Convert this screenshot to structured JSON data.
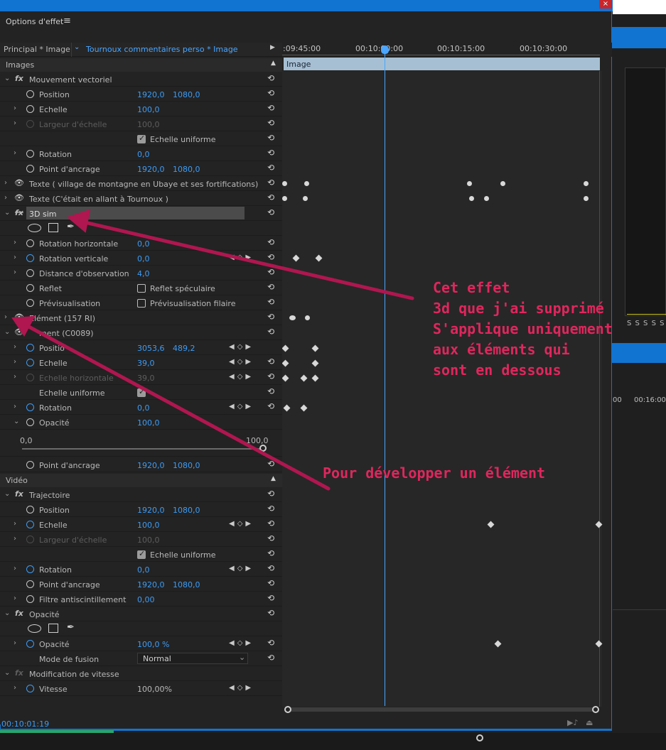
{
  "window": {
    "close_glyph": "×"
  },
  "panel": {
    "title": "Options d'effet",
    "menu_icon": "≡",
    "tab_master": "Principal * Image",
    "tab_clip": "Tournoux commentaires perso * Image",
    "play_glyph": "▶",
    "timecode": "00:10:01:19"
  },
  "ruler": {
    "ticks": [
      ":09:45:00",
      "00:10:00:00",
      "00:10:15:00",
      "00:10:30:00"
    ],
    "clip_label": "Image"
  },
  "sections": {
    "images": "Images",
    "video": "Vidéo"
  },
  "rows": {
    "mv_title": "Mouvement vectoriel",
    "mv_position": "Position",
    "mv_position_x": "1920,0",
    "mv_position_y": "1080,0",
    "mv_echelle": "Echelle",
    "mv_echelle_v": "100,0",
    "mv_largeur": "Largeur d'échelle",
    "mv_largeur_v": "100,0",
    "mv_uniforme": "Echelle uniforme",
    "mv_rotation": "Rotation",
    "mv_rotation_v": "0,0",
    "mv_ancrage": "Point d'ancrage",
    "mv_ancrage_x": "1920,0",
    "mv_ancrage_y": "1080,0",
    "texte1": "Texte ( village de montagne en Ubaye et ses fortifications)",
    "texte2": "Texte (C'était en allant à Tournoux )",
    "td_title": "3D sim",
    "td_rot_h": "Rotation horizontale",
    "td_rot_h_v": "0,0",
    "td_rot_v": "Rotation verticale",
    "td_rot_v_v": "0,0",
    "td_dist": "Distance d'observation",
    "td_dist_v": "4,0",
    "td_reflet": "Reflet",
    "td_reflet_opt": "Reflet spéculaire",
    "td_previs": "Prévisualisation",
    "td_previs_opt": "Prévisualisation filaire",
    "el1": "Elément (157 RI)",
    "el2": "ment (C0089)",
    "el2_position": "Positio",
    "el2_position_x": "3053,6",
    "el2_position_y": "489,2",
    "el2_echelle": "Echelle",
    "el2_echelle_v": "39,0",
    "el2_ech_h": "Echelle horizontale",
    "el2_ech_h_v": "39,0",
    "el2_uniforme": "Echelle uniforme",
    "el2_rotation": "Rotation",
    "el2_rotation_v": "0,0",
    "el2_opacite": "Opacité",
    "el2_opacite_v": "100,0",
    "slider_min": "0,0",
    "slider_max": "100,0",
    "el2_ancrage": "Point d'ancrage",
    "el2_ancrage_x": "1920,0",
    "el2_ancrage_y": "1080,0",
    "tr_title": "Trajectoire",
    "tr_position": "Position",
    "tr_position_x": "1920,0",
    "tr_position_y": "1080,0",
    "tr_echelle": "Echelle",
    "tr_echelle_v": "100,0",
    "tr_largeur": "Largeur d'échelle",
    "tr_largeur_v": "100,0",
    "tr_uniforme": "Echelle uniforme",
    "tr_rotation": "Rotation",
    "tr_rotation_v": "0,0",
    "tr_ancrage": "Point d'ancrage",
    "tr_ancrage_x": "1920,0",
    "tr_ancrage_y": "1080,0",
    "tr_filtre": "Filtre antiscintillement",
    "tr_filtre_v": "0,00",
    "op_title": "Opacité",
    "op_opacite": "Opacité",
    "op_opacite_v": "100,0 %",
    "op_fusion": "Mode de fusion",
    "op_fusion_v": "Normal",
    "mv2_title": "Modification de vitesse",
    "mv2_vitesse": "Vitesse",
    "mv2_vitesse_v": "100,00%"
  },
  "right_panel": {
    "s_labels": "S S S S S",
    "time1": "00",
    "time2": "00:16:00:"
  },
  "annotations": {
    "a1_l1": "Cet effet",
    "a1_l2": "3d que j'ai supprimé",
    "a1_l3": "S'applique uniquement",
    "a1_l4": "aux éléments qui",
    "a1_l5": "sont en dessous",
    "a2": "Pour développer un élément"
  },
  "colors": {
    "accent_blue": "#1174d1",
    "value_blue": "#3d9cf5",
    "annotation": "#e0265d",
    "clip_bar": "#a6bfd3"
  }
}
